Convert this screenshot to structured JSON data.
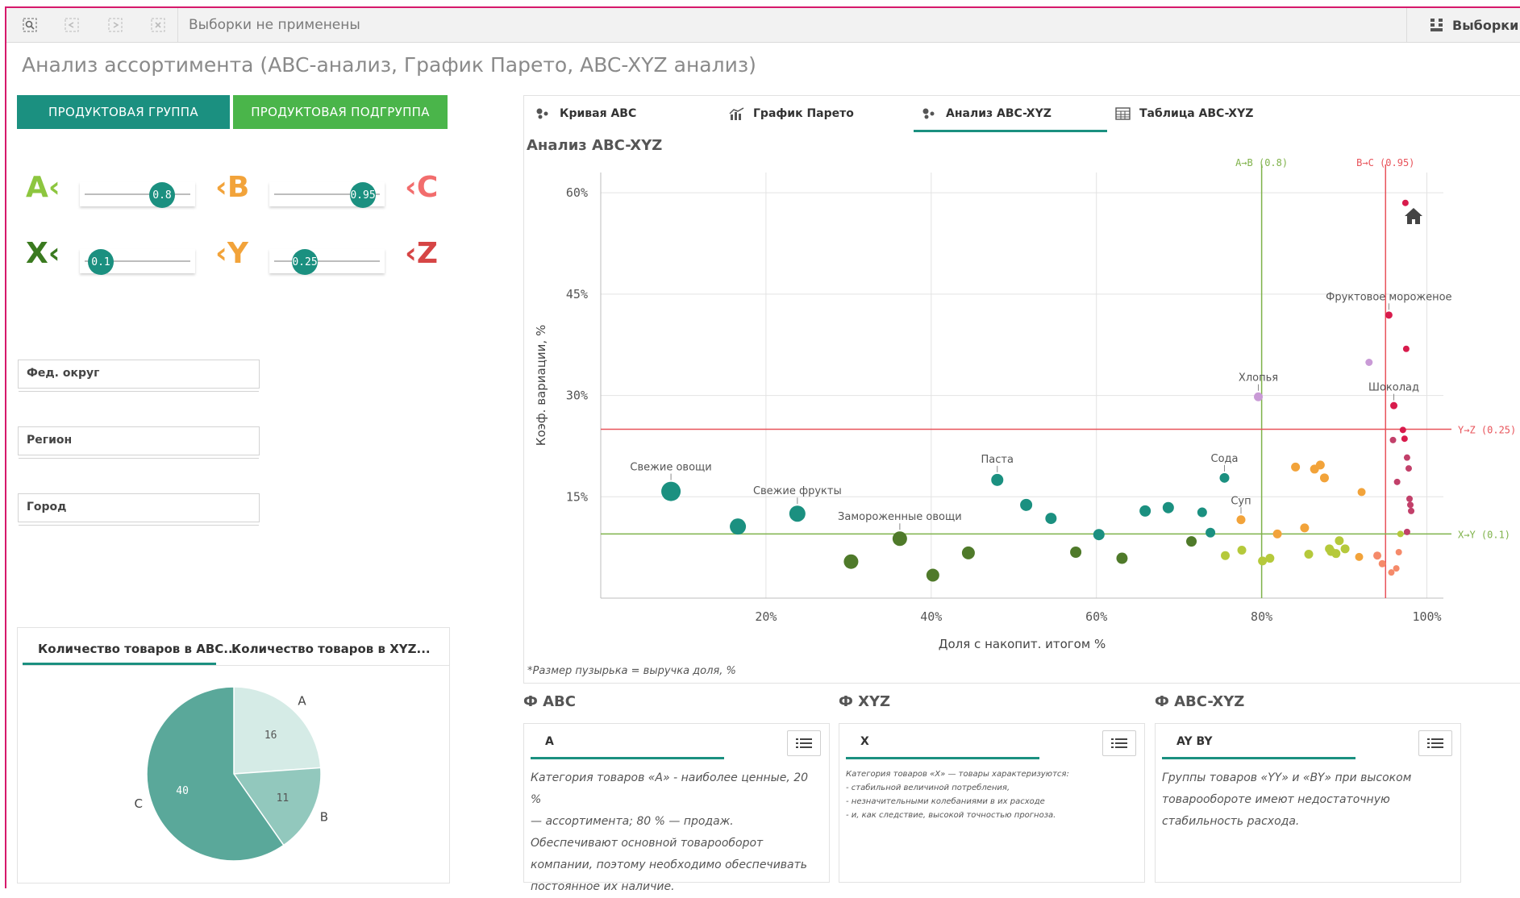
{
  "toolbar": {
    "selections_text": "Выборки не применены",
    "selections_button": "Выборки"
  },
  "sheet_title": "Анализ ассортимента (ABC-анализ, График Парето, ABC-XYZ анализ)",
  "dimension_buttons": {
    "product_group": "ПРОДУКТОВАЯ ГРУППА",
    "product_subgroup": "ПРОДУКТОВАЯ ПОДГРУППА",
    "product_group_color": "#1b9080",
    "product_subgroup_color": "#4ab54a"
  },
  "thresholds": {
    "a_label": "A‹",
    "b_label": "‹B",
    "c_label": "‹C",
    "x_label": "X‹",
    "y_label": "‹Y",
    "z_label": "‹Z",
    "ab_value": "0.8",
    "bc_value": "0.95",
    "xy_value": "0.1",
    "yz_value": "0.25"
  },
  "filters": {
    "district": "Фед. округ",
    "region": "Регион",
    "city": "Город"
  },
  "pie_panel": {
    "tab_abc": "Количество товаров в ABC...",
    "tab_xyz": "Количество товаров в XYZ..."
  },
  "chart_tabs": {
    "curve": "Кривая ABC",
    "pareto": "График Парето",
    "abcxyz": "Анализ ABC-XYZ",
    "table": "Таблица ABC-XYZ"
  },
  "chart_data": [
    {
      "type": "scatter",
      "title": "Анализ ABC-XYZ",
      "xlabel": "Доля с накопит. итогом %",
      "ylabel": "Коэф. вариации, %",
      "footnote": "*Размер пузырька = выручка доля, %",
      "xlim": [
        0,
        102
      ],
      "ylim": [
        0,
        63
      ],
      "x_ticks": [
        20,
        40,
        60,
        80,
        100
      ],
      "x_tick_labels": [
        "20%",
        "40%",
        "60%",
        "80%",
        "100%"
      ],
      "y_ticks": [
        15,
        30,
        45,
        60
      ],
      "y_tick_labels": [
        "15%",
        "30%",
        "45%",
        "60%"
      ],
      "grid": true,
      "ref_lines": [
        {
          "axis": "x",
          "value": 80,
          "label": "A→B (0.8)",
          "color": "#7fb24a"
        },
        {
          "axis": "x",
          "value": 95,
          "label": "B→C (0.95)",
          "color": "#e8535a"
        },
        {
          "axis": "y",
          "value": 25,
          "label": "Y→Z (0.25)",
          "color": "#e8535a"
        },
        {
          "axis": "y",
          "value": 9.5,
          "label": "X→Y (0.1)",
          "color": "#7fb24a"
        }
      ],
      "points": [
        {
          "x": 8.5,
          "y": 15.8,
          "size": 12,
          "color": "#1b9080",
          "label": "Свежие овощи"
        },
        {
          "x": 16.6,
          "y": 10.6,
          "size": 10,
          "color": "#1b9080"
        },
        {
          "x": 23.8,
          "y": 12.5,
          "size": 10,
          "color": "#1b9080",
          "label": "Свежие фрукты"
        },
        {
          "x": 30.3,
          "y": 5.4,
          "size": 9,
          "color": "#4f7a2a"
        },
        {
          "x": 36.2,
          "y": 8.8,
          "size": 9,
          "color": "#4f7a2a",
          "label": "Замороженные овощи"
        },
        {
          "x": 40.2,
          "y": 3.4,
          "size": 8,
          "color": "#4f7a2a"
        },
        {
          "x": 44.5,
          "y": 6.7,
          "size": 8,
          "color": "#4f7a2a"
        },
        {
          "x": 48.0,
          "y": 17.5,
          "size": 7.5,
          "color": "#1b9080",
          "label": "Паста"
        },
        {
          "x": 51.5,
          "y": 13.8,
          "size": 7.5,
          "color": "#1b9080"
        },
        {
          "x": 54.5,
          "y": 11.8,
          "size": 7,
          "color": "#1b9080"
        },
        {
          "x": 57.5,
          "y": 6.8,
          "size": 7,
          "color": "#4f7a2a"
        },
        {
          "x": 60.3,
          "y": 9.4,
          "size": 7,
          "color": "#1b9080"
        },
        {
          "x": 63.1,
          "y": 5.9,
          "size": 7,
          "color": "#4f7a2a"
        },
        {
          "x": 65.9,
          "y": 12.9,
          "size": 7,
          "color": "#1b9080"
        },
        {
          "x": 68.7,
          "y": 13.4,
          "size": 7,
          "color": "#1b9080"
        },
        {
          "x": 71.5,
          "y": 8.4,
          "size": 6.5,
          "color": "#4f7a2a"
        },
        {
          "x": 72.8,
          "y": 12.7,
          "size": 6,
          "color": "#1b9080"
        },
        {
          "x": 73.8,
          "y": 9.7,
          "size": 6,
          "color": "#1b9080"
        },
        {
          "x": 75.5,
          "y": 17.8,
          "size": 6,
          "color": "#1b9080",
          "label": "Сода"
        },
        {
          "x": 75.6,
          "y": 6.3,
          "size": 5.5,
          "color": "#b5c93b"
        },
        {
          "x": 77.6,
          "y": 7.1,
          "size": 5.5,
          "color": "#b5c93b"
        },
        {
          "x": 79.6,
          "y": 29.8,
          "size": 5.5,
          "color": "#c99ad6",
          "label": "Хлопья"
        },
        {
          "x": 77.5,
          "y": 11.6,
          "size": 5.5,
          "color": "#f2a33a",
          "label": "Суп"
        },
        {
          "x": 80.1,
          "y": 5.5,
          "size": 5.5,
          "color": "#b5c93b"
        },
        {
          "x": 81.0,
          "y": 5.9,
          "size": 5.5,
          "color": "#b5c93b"
        },
        {
          "x": 81.9,
          "y": 9.5,
          "size": 5.5,
          "color": "#f2a33a"
        },
        {
          "x": 84.1,
          "y": 19.4,
          "size": 5.5,
          "color": "#f2a33a"
        },
        {
          "x": 85.2,
          "y": 10.4,
          "size": 5.5,
          "color": "#f2a33a"
        },
        {
          "x": 85.7,
          "y": 6.5,
          "size": 5.5,
          "color": "#b5c93b"
        },
        {
          "x": 86.4,
          "y": 19.1,
          "size": 5.5,
          "color": "#f2a33a"
        },
        {
          "x": 87.1,
          "y": 19.7,
          "size": 5.5,
          "color": "#f2a33a"
        },
        {
          "x": 87.6,
          "y": 17.8,
          "size": 5.5,
          "color": "#f2a33a"
        },
        {
          "x": 88.2,
          "y": 7.3,
          "size": 5.5,
          "color": "#b5c93b"
        },
        {
          "x": 88.4,
          "y": 6.9,
          "size": 5.5,
          "color": "#b5c93b"
        },
        {
          "x": 89.0,
          "y": 6.6,
          "size": 5.5,
          "color": "#b5c93b"
        },
        {
          "x": 89.4,
          "y": 8.5,
          "size": 5.5,
          "color": "#b5c93b"
        },
        {
          "x": 90.1,
          "y": 7.3,
          "size": 5.5,
          "color": "#b5c93b"
        },
        {
          "x": 91.8,
          "y": 6.1,
          "size": 5,
          "color": "#f2a33a"
        },
        {
          "x": 92.1,
          "y": 15.7,
          "size": 5,
          "color": "#f2a33a"
        },
        {
          "x": 93.0,
          "y": 34.9,
          "size": 4.5,
          "color": "#c99ad6"
        },
        {
          "x": 94.0,
          "y": 6.3,
          "size": 5,
          "color": "#f58a6a"
        },
        {
          "x": 94.6,
          "y": 5.1,
          "size": 4.5,
          "color": "#f58a6a"
        },
        {
          "x": 95.7,
          "y": 3.8,
          "size": 4,
          "color": "#f58a6a"
        },
        {
          "x": 96.3,
          "y": 4.4,
          "size": 4,
          "color": "#f58a6a"
        },
        {
          "x": 96.6,
          "y": 6.8,
          "size": 4,
          "color": "#f58a6a"
        },
        {
          "x": 96.8,
          "y": 9.5,
          "size": 4,
          "color": "#b5c93b"
        },
        {
          "x": 95.4,
          "y": 41.9,
          "size": 4.5,
          "color": "#d81b4c",
          "label": "Фруктовое мороженое"
        },
        {
          "x": 96.0,
          "y": 28.5,
          "size": 4.5,
          "color": "#d81b4c",
          "label": "Шоколад"
        },
        {
          "x": 95.9,
          "y": 23.4,
          "size": 4,
          "color": "#c2406a"
        },
        {
          "x": 96.4,
          "y": 17.2,
          "size": 4,
          "color": "#c2406a"
        },
        {
          "x": 97.1,
          "y": 24.9,
          "size": 4,
          "color": "#d81b4c"
        },
        {
          "x": 97.3,
          "y": 23.6,
          "size": 4,
          "color": "#d81b4c"
        },
        {
          "x": 97.4,
          "y": 58.5,
          "size": 4,
          "color": "#d81b4c"
        },
        {
          "x": 97.5,
          "y": 36.9,
          "size": 4,
          "color": "#d81b4c"
        },
        {
          "x": 97.6,
          "y": 20.8,
          "size": 4,
          "color": "#c2406a"
        },
        {
          "x": 97.8,
          "y": 19.2,
          "size": 4,
          "color": "#c2406a"
        },
        {
          "x": 97.9,
          "y": 14.7,
          "size": 4,
          "color": "#c2406a"
        },
        {
          "x": 98.0,
          "y": 13.8,
          "size": 4,
          "color": "#c2406a"
        },
        {
          "x": 98.1,
          "y": 12.9,
          "size": 4,
          "color": "#c2406a"
        },
        {
          "x": 97.6,
          "y": 9.8,
          "size": 4,
          "color": "#c2406a"
        }
      ]
    },
    {
      "type": "pie",
      "categories": [
        "A",
        "B",
        "C"
      ],
      "values": [
        16,
        11,
        40
      ],
      "colors": [
        "#d5ebe6",
        "#92c8bd",
        "#5aa89a"
      ]
    }
  ],
  "kpi": {
    "abc": {
      "header": "Ф ABC",
      "value": "A",
      "text": [
        "Категория товаров «А» - наиболее ценные, 20 %",
        "— ассортимента; 80 % — продаж.",
        "Обеспечивают основной товарооборот",
        "компании, поэтому необходимо обеспечивать",
        "постоянное их наличие."
      ]
    },
    "xyz": {
      "header": "Ф XYZ",
      "value": "X",
      "text": [
        "Категория товаров «X» — товары характеризуются:",
        "- стабильной величиной потребления,",
        "- незначительными колебаниями в их расходе",
        "- и, как следствие, высокой точностью прогноза."
      ]
    },
    "abcxyz": {
      "header": "Ф ABC-XYZ",
      "value": "AY BY",
      "text": [
        "Группы товаров «YY» и «BY» при высоком",
        "товарообороте имеют недостаточную",
        "стабильность расхода."
      ]
    }
  }
}
